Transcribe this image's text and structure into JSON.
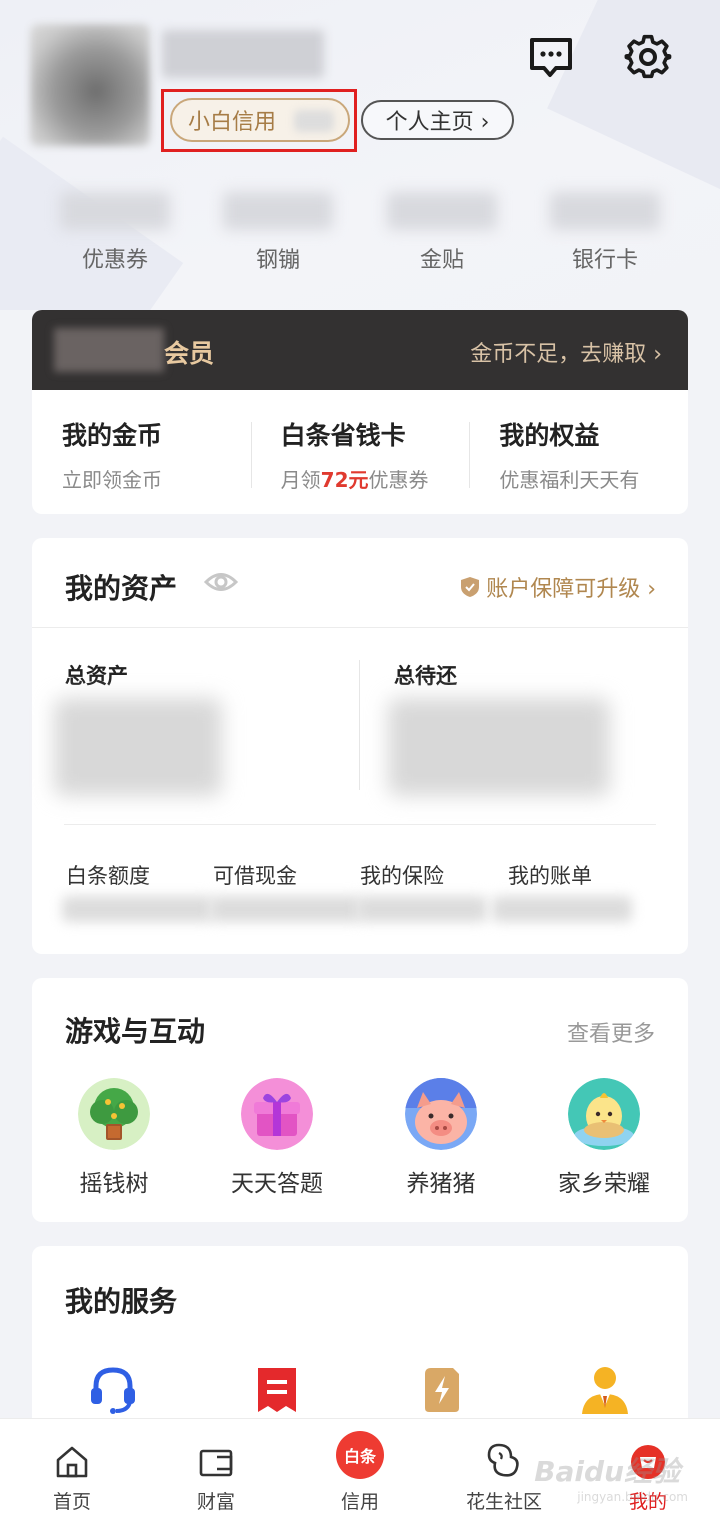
{
  "header": {
    "credit_label": "小白信用",
    "profile_label": "个人主页 ›"
  },
  "stats": [
    {
      "label": "优惠券"
    },
    {
      "label": "钢镚"
    },
    {
      "label": "金贴"
    },
    {
      "label": "银行卡"
    }
  ],
  "member": {
    "title": "会员",
    "earn_link": "金币不足，去赚取 ›",
    "cols": [
      {
        "title": "我的金币",
        "sub": "立即领金币"
      },
      {
        "title": "白条省钱卡",
        "sub_prefix": "月领",
        "sub_highlight": "72元",
        "sub_suffix": "优惠券"
      },
      {
        "title": "我的权益",
        "sub": "优惠福利天天有"
      }
    ]
  },
  "assets": {
    "title": "我的资产",
    "secure_link": "账户保障可升级 ›",
    "total_assets_label": "总资产",
    "total_due_label": "总待还",
    "sub_items": [
      "白条额度",
      "可借现金",
      "我的保险",
      "我的账单"
    ]
  },
  "games": {
    "title": "游戏与互动",
    "more": "查看更多",
    "items": [
      {
        "label": "摇钱树",
        "icon": "money-tree-icon"
      },
      {
        "label": "天天答题",
        "icon": "gift-box-icon"
      },
      {
        "label": "养猪猪",
        "icon": "pig-icon"
      },
      {
        "label": "家乡荣耀",
        "icon": "chick-icon"
      }
    ]
  },
  "services": {
    "title": "我的服务",
    "items": [
      {
        "icon": "headset-icon"
      },
      {
        "icon": "bill-icon"
      },
      {
        "icon": "power-card-icon"
      },
      {
        "icon": "agent-icon"
      }
    ]
  },
  "nav": {
    "items": [
      {
        "label": "首页",
        "icon": "home-icon"
      },
      {
        "label": "财富",
        "icon": "wallet-icon"
      },
      {
        "label": "信用",
        "icon": "baitiao-icon",
        "badge": "白条"
      },
      {
        "label": "花生社区",
        "icon": "peanut-icon"
      },
      {
        "label": "我的",
        "icon": "me-icon",
        "active": true
      }
    ]
  },
  "watermark": {
    "text": "Baidu经验",
    "sub": "jingyan.baidu.com"
  },
  "colors": {
    "accent_red": "#e02020",
    "gold": "#b0874f",
    "member_dark": "#333131"
  }
}
